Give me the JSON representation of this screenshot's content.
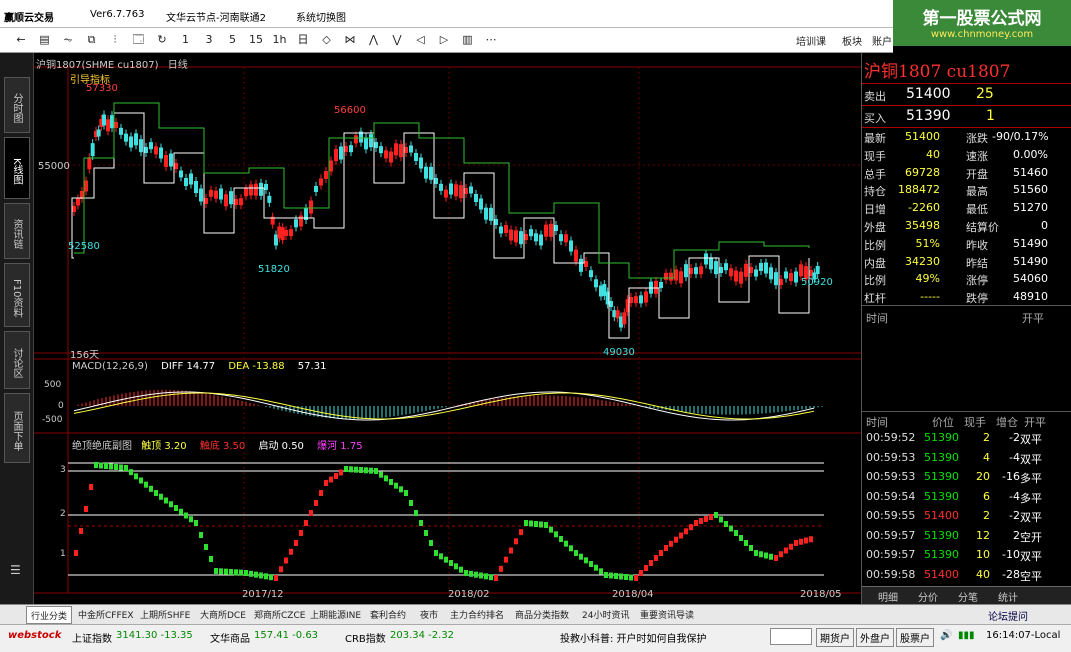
{
  "titlebar": {
    "app": "赢顺云交易",
    "version": "Ver6.7.763",
    "node": "文华云节点-河南联通2",
    "menu_system": "系统切换图"
  },
  "watermark": {
    "line1": "第一股票公式网",
    "line2": "www.chnmoney.com"
  },
  "toolbar": {
    "buttons": [
      "←",
      "▤",
      "⏦",
      "⧉",
      "⫶",
      "🗔",
      "↻",
      "1",
      "3",
      "5",
      "15",
      "1h",
      "日",
      "◇",
      "⋈",
      "⋀",
      "⋁",
      "◁",
      "▷",
      "▥",
      "⋯"
    ],
    "right": [
      "培训课",
      "板块",
      "账户"
    ]
  },
  "lefttabs": [
    "分时图",
    "K线图",
    "资讯链",
    "F10资料",
    "讨论区",
    "页面下单"
  ],
  "chart": {
    "header_symbol": "沪铜1807(SHME cu1807)",
    "header_period": "日线",
    "indicator_main": "引导指标",
    "price_labels": {
      "high1": "57330",
      "high2": "56600",
      "low1": "52580",
      "low2": "51820",
      "low3": "49030",
      "last": "50920",
      "y55000": "55000"
    },
    "x_labels": [
      "2017/12",
      "2018/02",
      "2018/04",
      "2018/05"
    ],
    "days": "156天",
    "macd": {
      "name": "MACD(12,26,9)",
      "diff_label": "DIFF",
      "diff": "14.77",
      "dea_label": "DEA",
      "dea": "-13.88",
      "macd": "57.31",
      "y_ticks": [
        "500",
        "0",
        "-500"
      ]
    },
    "bottom": {
      "name": "绝顶绝底副图",
      "k1": "触顶",
      "v1": "3.20",
      "k2": "触底",
      "v2": "3.50",
      "k3": "启动",
      "v3": "0.50",
      "k4": "爆河",
      "v4": "1.75",
      "y_ticks": [
        "3",
        "2",
        "1"
      ]
    }
  },
  "quote": {
    "title": "沪铜1807 cu1807",
    "sell_label": "卖出",
    "sell_price": "51400",
    "sell_qty": "25",
    "buy_label": "买入",
    "buy_price": "51390",
    "buy_qty": "1",
    "rows": [
      [
        "最新",
        "51400",
        "涨跌",
        "-90/0.17%"
      ],
      [
        "现手",
        "40",
        "速涨",
        "0.00%"
      ],
      [
        "总手",
        "69728",
        "开盘",
        "51460"
      ],
      [
        "持仓",
        "188472",
        "最高",
        "51560"
      ],
      [
        "日增",
        "-2260",
        "最低",
        "51270"
      ],
      [
        "外盘",
        "35498",
        "结算价",
        "0"
      ],
      [
        "比例",
        "51%",
        "昨收",
        "51490"
      ],
      [
        "内盘",
        "34230",
        "昨结",
        "51490"
      ],
      [
        "比例",
        "49%",
        "涨停",
        "54060"
      ],
      [
        "杠杆",
        "-----",
        "跌停",
        "48910"
      ]
    ],
    "tick_header": [
      "时间",
      "价位",
      "现手",
      "增仓",
      "开平"
    ],
    "ticks": [
      [
        "00:59:52",
        "51390",
        "2",
        "-2",
        "双平"
      ],
      [
        "00:59:53",
        "51390",
        "4",
        "-4",
        "双平"
      ],
      [
        "00:59:53",
        "51390",
        "20",
        "-16",
        "多平"
      ],
      [
        "00:59:54",
        "51390",
        "6",
        "-4",
        "多平"
      ],
      [
        "00:59:55",
        "51400",
        "2",
        "-2",
        "双平"
      ],
      [
        "00:59:57",
        "51390",
        "12",
        "2",
        "空开"
      ],
      [
        "00:59:57",
        "51390",
        "10",
        "-10",
        "双平"
      ],
      [
        "00:59:58",
        "51400",
        "40",
        "-28",
        "空平"
      ]
    ],
    "bottom_tabs": [
      "明细",
      "分价",
      "分笔",
      "统计"
    ]
  },
  "bottomtabs": [
    "行业分类",
    "中金所CFFEX",
    "上期所SHFE",
    "大商所DCE",
    "郑商所CZCE",
    "上期能源INE",
    "套利合约",
    "夜市",
    "主力合约排名",
    "商品分类指数",
    "24小时资讯",
    "重要资讯导读"
  ],
  "bottom_right": "论坛提问",
  "status": {
    "logo": "webstock",
    "i1": "上证指数",
    "v1": "3141.30 -13.35",
    "i2": "文华商品",
    "v2": "157.41 -0.63",
    "i3": "CRB指数",
    "v3": "203.34 -2.32",
    "tip": "投教小科普: 开户时如何自我保护",
    "b1": "期货户",
    "b2": "外盘户",
    "b3": "股票户",
    "time": "16:14:07-Local"
  }
}
